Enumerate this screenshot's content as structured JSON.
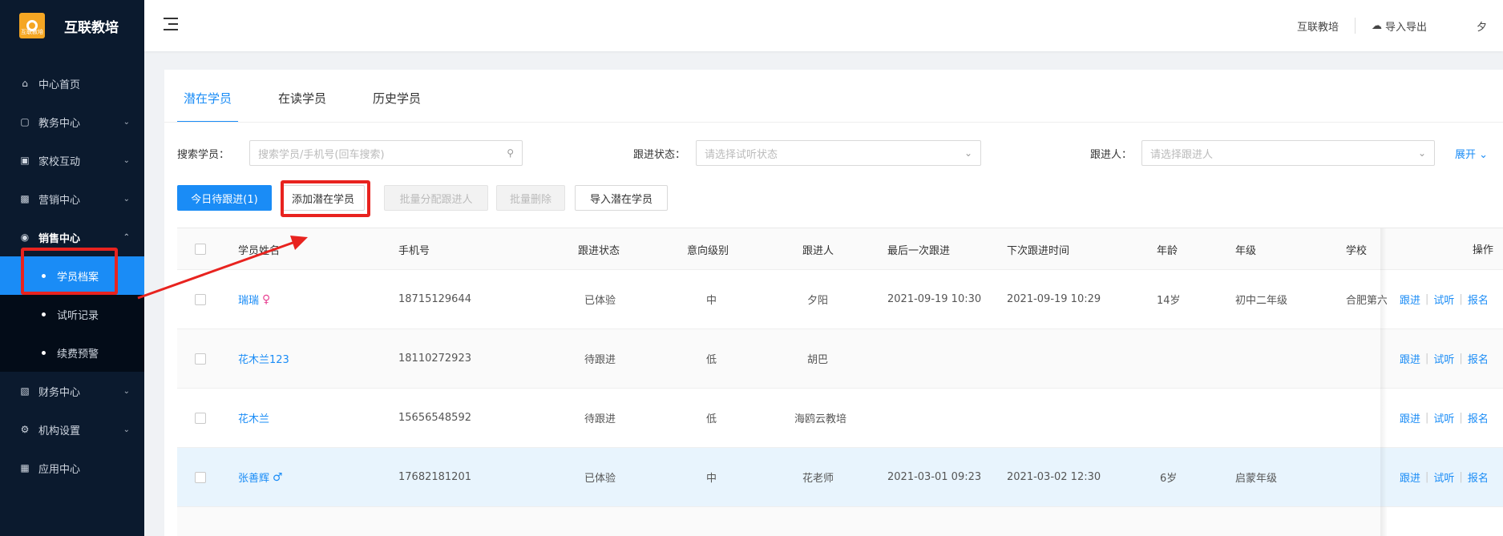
{
  "app": {
    "name": "互联教培",
    "logo_text": "互联教培"
  },
  "sidebar": {
    "items": [
      {
        "label": "中心首页",
        "icon": "home-icon"
      },
      {
        "label": "教务中心",
        "icon": "book-icon"
      },
      {
        "label": "家校互动",
        "icon": "chat-icon"
      },
      {
        "label": "营销中心",
        "icon": "bag-icon"
      },
      {
        "label": "销售中心",
        "icon": "users-icon"
      },
      {
        "label": "财务中心",
        "icon": "wallet-icon"
      },
      {
        "label": "机构设置",
        "icon": "gear-icon"
      },
      {
        "label": "应用中心",
        "icon": "grid-icon"
      }
    ],
    "sales_sub": [
      {
        "label": "学员档案"
      },
      {
        "label": "试听记录"
      },
      {
        "label": "续费预警"
      }
    ]
  },
  "header": {
    "org": "互联教培",
    "import_export": "导入导出",
    "cut_text": "夕"
  },
  "tabs": [
    {
      "label": "潜在学员"
    },
    {
      "label": "在读学员"
    },
    {
      "label": "历史学员"
    }
  ],
  "filters": {
    "search_label": "搜索学员：",
    "search_placeholder": "搜索学员/手机号(回车搜索)",
    "status_label": "跟进状态：",
    "status_placeholder": "请选择试听状态",
    "follower_label": "跟进人：",
    "follower_placeholder": "请选择跟进人",
    "expand": "展开"
  },
  "buttons": {
    "today": "今日待跟进(1)",
    "add": "添加潜在学员",
    "batch_assign": "批量分配跟进人",
    "batch_delete": "批量删除",
    "import": "导入潜在学员"
  },
  "table": {
    "columns": [
      "学员姓名",
      "手机号",
      "跟进状态",
      "意向级别",
      "跟进人",
      "最后一次跟进",
      "下次跟进时间",
      "年龄",
      "年级",
      "学校",
      "操作"
    ],
    "rows": [
      {
        "name": "瑞瑞",
        "gender": "♀",
        "phone": "18715129644",
        "status": "已体验",
        "level": "中",
        "follower": "夕阳",
        "last": "2021-09-19 10:30",
        "next": "2021-09-19 10:29",
        "age": "14岁",
        "grade": "初中二年级",
        "school": "合肥第六"
      },
      {
        "name": "花木兰123",
        "gender": "",
        "phone": "18110272923",
        "status": "待跟进",
        "level": "低",
        "follower": "胡巴",
        "last": "",
        "next": "",
        "age": "",
        "grade": "",
        "school": ""
      },
      {
        "name": "花木兰",
        "gender": "",
        "phone": "15656548592",
        "status": "待跟进",
        "level": "低",
        "follower": "海鸥云教培",
        "last": "",
        "next": "",
        "age": "",
        "grade": "",
        "school": ""
      },
      {
        "name": "张善辉",
        "gender": "♂",
        "phone": "17682181201",
        "status": "已体验",
        "level": "中",
        "follower": "花老师",
        "last": "2021-03-01 09:23",
        "next": "2021-03-02 12:30",
        "age": "6岁",
        "grade": "启蒙年级",
        "school": ""
      }
    ],
    "ops": [
      "跟进",
      "试听",
      "报名"
    ]
  },
  "colors": {
    "primary": "#1a8cf6",
    "sidebar_bg": "#0b1a2e",
    "annotation_red": "#e8231f"
  }
}
